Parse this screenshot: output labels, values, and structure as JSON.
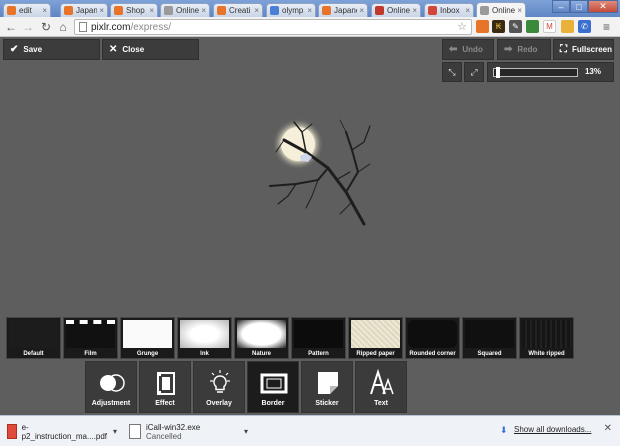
{
  "browser": {
    "tabs": [
      {
        "label": "edit",
        "favicon_color": "#e8742a"
      },
      {
        "label": "Japane",
        "favicon_color": "#e8742a"
      },
      {
        "label": "Shop",
        "favicon_color": "#e8742a"
      },
      {
        "label": "Online",
        "favicon_color": "#9a9a9a"
      },
      {
        "label": "Creati",
        "favicon_color": "#e8742a"
      },
      {
        "label": "olymp",
        "favicon_color": "#4a7fd6"
      },
      {
        "label": "Japane",
        "favicon_color": "#e8742a"
      },
      {
        "label": "Online",
        "favicon_color": "#c0392b"
      },
      {
        "label": "Inbox",
        "favicon_color": "#d44638"
      },
      {
        "label": "Online",
        "favicon_color": "#9a9a9a"
      }
    ],
    "address": {
      "host": "pixlr.com",
      "path": "/express/"
    }
  },
  "app": {
    "save_label": "Save",
    "close_label": "Close",
    "undo_label": "Undo",
    "redo_label": "Redo",
    "fullscreen_label": "Fullscreen",
    "zoom": {
      "value": 0.13,
      "label": "13%"
    }
  },
  "borders": [
    {
      "label": "Default"
    },
    {
      "label": "Film"
    },
    {
      "label": "Grunge"
    },
    {
      "label": "Ink"
    },
    {
      "label": "Nature"
    },
    {
      "label": "Pattern"
    },
    {
      "label": "Ripped paper"
    },
    {
      "label": "Rounded corner"
    },
    {
      "label": "Squared"
    },
    {
      "label": "White ripped"
    }
  ],
  "categories": [
    {
      "label": "Adjustment",
      "icon": "adjustment-icon"
    },
    {
      "label": "Effect",
      "icon": "effect-icon"
    },
    {
      "label": "Overlay",
      "icon": "overlay-icon"
    },
    {
      "label": "Border",
      "icon": "border-icon",
      "active": true
    },
    {
      "label": "Sticker",
      "icon": "sticker-icon"
    },
    {
      "label": "Text",
      "icon": "text-icon"
    }
  ],
  "downloads": {
    "items": [
      {
        "name": "e-p2_instruction_ma....pdf",
        "status": ""
      },
      {
        "name": "iCall-win32.exe",
        "status": "Cancelled"
      }
    ],
    "show_all": "Show all downloads..."
  }
}
